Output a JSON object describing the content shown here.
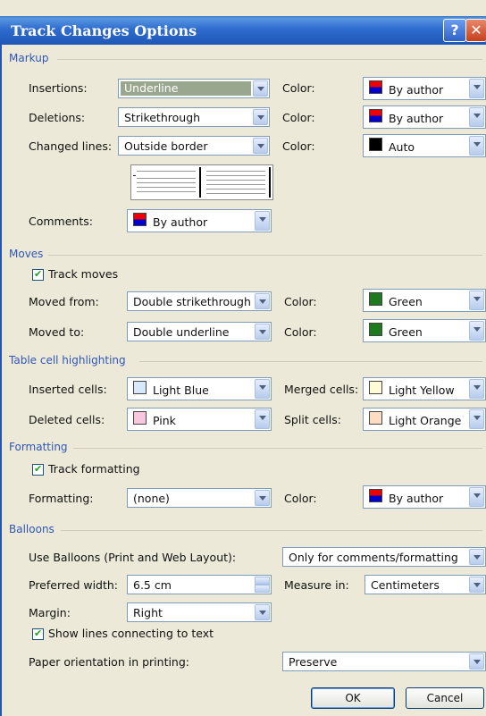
{
  "window": {
    "title": "Track Changes Options"
  },
  "sections": {
    "markup": "Markup",
    "moves": "Moves",
    "table": "Table cell highlighting",
    "formatting": "Formatting",
    "balloons": "Balloons"
  },
  "markup": {
    "insertions_label": "Insertions:",
    "insertions_value": "Underline",
    "insertions_color_label": "Color:",
    "insertions_color": "By author",
    "deletions_label": "Deletions:",
    "deletions_value": "Strikethrough",
    "deletions_color_label": "Color:",
    "deletions_color": "By author",
    "changed_label": "Changed lines:",
    "changed_value": "Outside border",
    "changed_color_label": "Color:",
    "changed_color": "Auto",
    "comments_label": "Comments:",
    "comments_value": "By author"
  },
  "moves": {
    "track_label": "Track moves",
    "from_label": "Moved from:",
    "from_value": "Double strikethrough",
    "from_color_label": "Color:",
    "from_color": "Green",
    "to_label": "Moved to:",
    "to_value": "Double underline",
    "to_color_label": "Color:",
    "to_color": "Green"
  },
  "table": {
    "inserted_label": "Inserted cells:",
    "inserted_value": "Light Blue",
    "merged_label": "Merged cells:",
    "merged_value": "Light Yellow",
    "deleted_label": "Deleted cells:",
    "deleted_value": "Pink",
    "split_label": "Split cells:",
    "split_value": "Light Orange"
  },
  "formatting": {
    "track_label": "Track formatting",
    "label": "Formatting:",
    "value": "(none)",
    "color_label": "Color:",
    "color": "By author"
  },
  "balloons": {
    "use_label": "Use Balloons (Print and Web Layout):",
    "use_value": "Only for comments/formatting",
    "width_label": "Preferred width:",
    "width_value": "6.5 cm",
    "measure_label": "Measure in:",
    "measure_value": "Centimeters",
    "margin_label": "Margin:",
    "margin_value": "Right",
    "show_lines_label": "Show lines connecting to text",
    "paper_label": "Paper orientation in printing:",
    "paper_value": "Preserve"
  },
  "buttons": {
    "ok": "OK",
    "cancel": "Cancel"
  },
  "colors": {
    "green": "#1e7a1e",
    "light_blue": "#d7e8fb",
    "light_yellow": "#fffbd6",
    "pink": "#f9c7dd",
    "light_orange": "#fcdcc2",
    "auto": "#000000"
  }
}
